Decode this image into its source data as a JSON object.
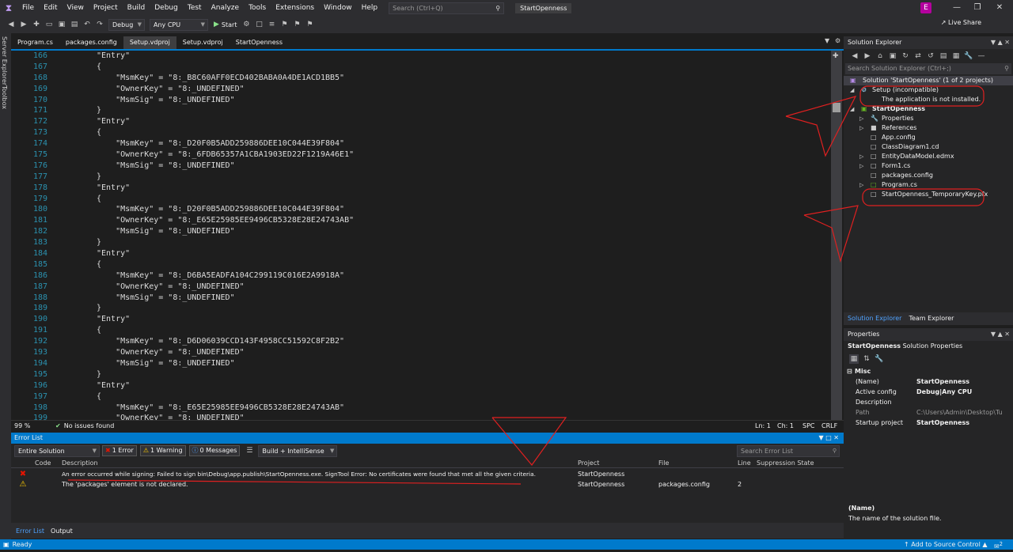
{
  "menu": {
    "items": [
      "File",
      "Edit",
      "View",
      "Project",
      "Build",
      "Debug",
      "Test",
      "Analyze",
      "Tools",
      "Extensions",
      "Window",
      "Help"
    ],
    "search_placeholder": "Search (Ctrl+Q)",
    "solution_name": "StartOpenness",
    "user_initial": "E"
  },
  "toolbar": {
    "config": "Debug",
    "platform": "Any CPU",
    "start_label": "Start",
    "live_share": "Live Share"
  },
  "left_strip": {
    "server_explorer": "Server Explorer",
    "toolbox": "Toolbox"
  },
  "tabs": [
    "Program.cs",
    "packages.config",
    "Setup.vdproj",
    "Setup.vdproj",
    "StartOpenness"
  ],
  "editor": {
    "lines": [
      {
        "n": "166",
        "t": "\"Entry\""
      },
      {
        "n": "167",
        "t": "{"
      },
      {
        "n": "168",
        "t": "    \"MsmKey\" = \"8:_B8C60AFF0ECD402BABA0A4DE1ACD1BB5\""
      },
      {
        "n": "169",
        "t": "    \"OwnerKey\" = \"8:_UNDEFINED\""
      },
      {
        "n": "170",
        "t": "    \"MsmSig\" = \"8:_UNDEFINED\""
      },
      {
        "n": "171",
        "t": "}"
      },
      {
        "n": "172",
        "t": "\"Entry\""
      },
      {
        "n": "173",
        "t": "{"
      },
      {
        "n": "174",
        "t": "    \"MsmKey\" = \"8:_D20F0B5ADD259886DEE10C044E39F804\""
      },
      {
        "n": "175",
        "t": "    \"OwnerKey\" = \"8:_6FDB65357A1CBA1903ED22F1219A46E1\""
      },
      {
        "n": "176",
        "t": "    \"MsmSig\" = \"8:_UNDEFINED\""
      },
      {
        "n": "177",
        "t": "}"
      },
      {
        "n": "178",
        "t": "\"Entry\""
      },
      {
        "n": "179",
        "t": "{"
      },
      {
        "n": "180",
        "t": "    \"MsmKey\" = \"8:_D20F0B5ADD259886DEE10C044E39F804\""
      },
      {
        "n": "181",
        "t": "    \"OwnerKey\" = \"8:_E65E25985EE9496CB5328E28E24743AB\""
      },
      {
        "n": "182",
        "t": "    \"MsmSig\" = \"8:_UNDEFINED\""
      },
      {
        "n": "183",
        "t": "}"
      },
      {
        "n": "184",
        "t": "\"Entry\""
      },
      {
        "n": "185",
        "t": "{"
      },
      {
        "n": "186",
        "t": "    \"MsmKey\" = \"8:_D6BA5EADFA104C299119C016E2A9918A\""
      },
      {
        "n": "187",
        "t": "    \"OwnerKey\" = \"8:_UNDEFINED\""
      },
      {
        "n": "188",
        "t": "    \"MsmSig\" = \"8:_UNDEFINED\""
      },
      {
        "n": "189",
        "t": "}"
      },
      {
        "n": "190",
        "t": "\"Entry\""
      },
      {
        "n": "191",
        "t": "{"
      },
      {
        "n": "192",
        "t": "    \"MsmKey\" = \"8:_D6D06039CCD143F4958CC51592C8F2B2\""
      },
      {
        "n": "193",
        "t": "    \"OwnerKey\" = \"8:_UNDEFINED\""
      },
      {
        "n": "194",
        "t": "    \"MsmSig\" = \"8:_UNDEFINED\""
      },
      {
        "n": "195",
        "t": "}"
      },
      {
        "n": "196",
        "t": "\"Entry\""
      },
      {
        "n": "197",
        "t": "{"
      },
      {
        "n": "198",
        "t": "    \"MsmKey\" = \"8:_E65E25985EE9496CB5328E28E24743AB\""
      },
      {
        "n": "199",
        "t": "    \"OwnerKey\" = \"8:_UNDEFINED\""
      }
    ]
  },
  "editor_status": {
    "zoom": "99 %",
    "issues": "No issues found",
    "ln": "Ln: 1",
    "ch": "Ch: 1",
    "spc": "SPC",
    "crlf": "CRLF"
  },
  "error_list": {
    "title": "Error List",
    "scope": "Entire Solution",
    "errors_btn": "1 Error",
    "warnings_btn": "1 Warning",
    "messages_btn": "0 Messages",
    "build_filter": "Build + IntelliSense",
    "search_placeholder": "Search Error List",
    "headers": {
      "code": "Code",
      "description": "Description",
      "project": "Project",
      "file": "File",
      "line": "Line",
      "suppression": "Suppression State"
    },
    "rows": [
      {
        "type": "error",
        "description": "An error occurred while signing: Failed to sign bin\\Debug\\app.publish\\StartOpenness.exe. SignTool Error: No certificates were found that met all the given criteria.",
        "project": "StartOpenness",
        "file": "",
        "line": ""
      },
      {
        "type": "warning",
        "description": "The 'packages' element is not declared.",
        "project": "StartOpenness",
        "file": "packages.config",
        "line": "2"
      }
    ]
  },
  "bottom_tabs": {
    "error_list": "Error List",
    "output": "Output"
  },
  "solution_explorer": {
    "title": "Solution Explorer",
    "search_placeholder": "Search Solution Explorer (Ctrl+;)",
    "solution": "Solution 'StartOpenness' (1 of 2 projects)",
    "setup": "Setup (incompatible)",
    "setup_note": "The application is not installed.",
    "project": "StartOpenness",
    "items": [
      "Properties",
      "References",
      "App.config",
      "ClassDiagram1.cd",
      "EntityDataModel.edmx",
      "Form1.cs",
      "packages.config",
      "Program.cs",
      "StartOpenness_TemporaryKey.pfx"
    ],
    "tab_solution": "Solution Explorer",
    "tab_team": "Team Explorer"
  },
  "properties": {
    "title": "Properties",
    "object": "StartOpenness",
    "object_type": "Solution Properties",
    "category": "Misc",
    "rows": [
      {
        "k": "(Name)",
        "v": "StartOpenness"
      },
      {
        "k": "Active config",
        "v": "Debug|Any CPU"
      },
      {
        "k": "Description",
        "v": ""
      },
      {
        "k": "Path",
        "v": "C:\\Users\\Admin\\Desktop\\Tu"
      },
      {
        "k": "Startup project",
        "v": "StartOpenness"
      }
    ],
    "desc_title": "(Name)",
    "desc_text": "The name of the solution file."
  },
  "statusbar": {
    "ready": "Ready",
    "source_control": "Add to Source Control",
    "notif_count": "2"
  },
  "colors": {
    "accent": "#007acc",
    "error": "#e51400",
    "warning": "#ffcc00",
    "annotation": "#e02020"
  }
}
